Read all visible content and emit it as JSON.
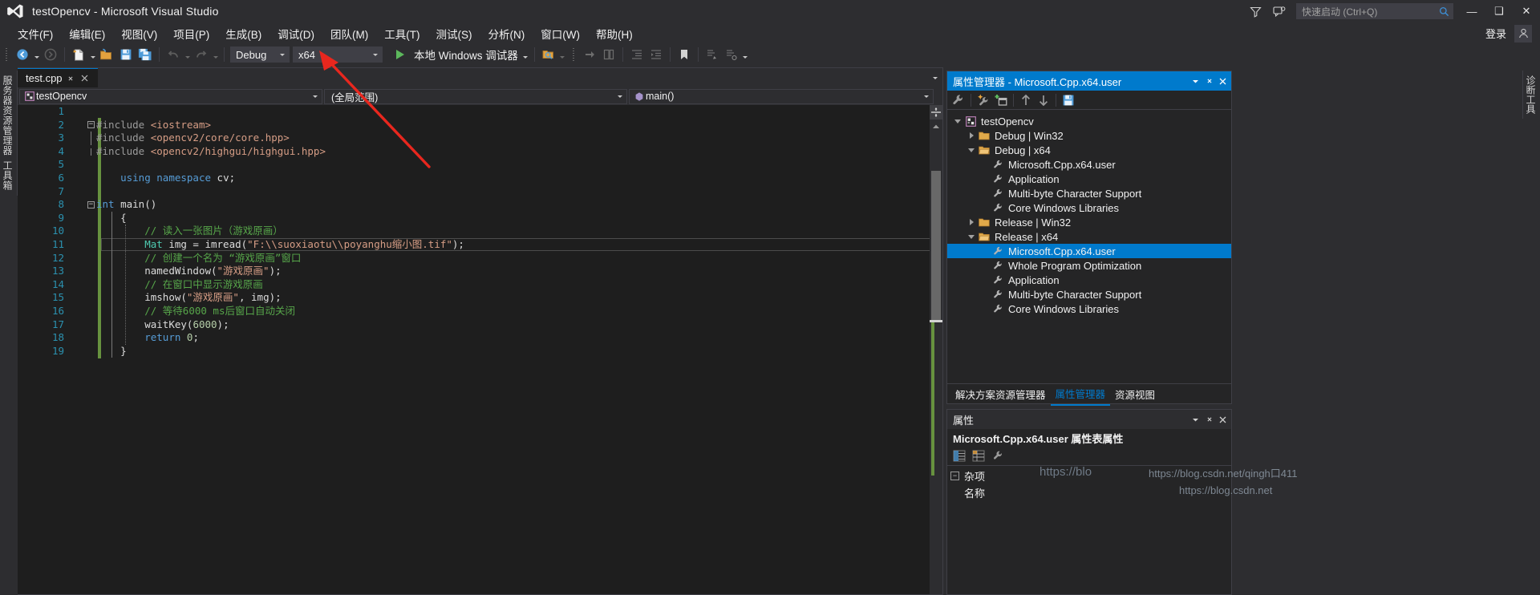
{
  "window": {
    "title": "testOpencv - Microsoft Visual Studio",
    "logo_name": "visual-studio-logo",
    "minimize": "—",
    "maximize": "❑",
    "close": "✕"
  },
  "titlebar": {
    "filter_icon": "feedback-filter-icon",
    "feedback_icon": "send-feedback-icon",
    "quick_launch_placeholder": "快速启动 (Ctrl+Q)",
    "quick_launch_value": "",
    "search_icon": "search-icon"
  },
  "menubar": {
    "items": [
      {
        "label": "文件(F)",
        "name": "menu-file"
      },
      {
        "label": "编辑(E)",
        "name": "menu-edit"
      },
      {
        "label": "视图(V)",
        "name": "menu-view"
      },
      {
        "label": "项目(P)",
        "name": "menu-project"
      },
      {
        "label": "生成(B)",
        "name": "menu-build"
      },
      {
        "label": "调试(D)",
        "name": "menu-debug"
      },
      {
        "label": "团队(M)",
        "name": "menu-team"
      },
      {
        "label": "工具(T)",
        "name": "menu-tools"
      },
      {
        "label": "测试(S)",
        "name": "menu-test"
      },
      {
        "label": "分析(N)",
        "name": "menu-analyze"
      },
      {
        "label": "窗口(W)",
        "name": "menu-window"
      },
      {
        "label": "帮助(H)",
        "name": "menu-help"
      }
    ],
    "signin_label": "登录",
    "account_icon": "account-icon"
  },
  "toolbar": {
    "back_icon": "navigate-back-icon",
    "forward_icon": "navigate-forward-icon",
    "new_item_icon": "new-item-icon",
    "open_icon": "open-file-icon",
    "save_icon": "save-icon",
    "save_all_icon": "save-all-icon",
    "undo_icon": "undo-icon",
    "redo_icon": "redo-icon",
    "config_label": "Debug",
    "platform_label": "x64",
    "run_label": "本地 Windows 调试器",
    "run_icon": "play-icon",
    "find_icon": "find-in-files-icon",
    "step_icons": [
      "step-over-icon",
      "step-into-icon"
    ],
    "indent_icons": [
      "decrease-indent-icon",
      "increase-indent-icon"
    ],
    "bookmark_icon": "bookmark-icon",
    "comment_icons": [
      "comment-icon",
      "uncomment-icon",
      "toggle-icon"
    ],
    "overflow_icon": "toolbar-overflow-icon"
  },
  "left_rail": {
    "tabs": [
      "服务器资源管理器",
      "工具箱"
    ]
  },
  "right_rail": {
    "tabs": [
      "诊断工具"
    ]
  },
  "editor": {
    "tab_label": "test.cpp",
    "tab_pin_icon": "pin-icon",
    "tab_close_icon": "close-icon",
    "tabstrip_menu_icon": "chevron-down-icon",
    "nav_project": "testOpencv",
    "nav_project_icon": "cpp-project-icon",
    "nav_scope": "(全局范围)",
    "nav_member": "main()",
    "nav_member_icon": "method-icon",
    "code_lines": [
      {
        "n": 1,
        "fold": "",
        "indent": 0,
        "tokens": []
      },
      {
        "n": 2,
        "fold": "minus",
        "indent": 0,
        "tokens": [
          {
            "t": "#include ",
            "c": "pp"
          },
          {
            "t": "<iostream>",
            "c": "hdr"
          }
        ]
      },
      {
        "n": 3,
        "fold": "bar",
        "indent": 0,
        "tokens": [
          {
            "t": "#include ",
            "c": "pp"
          },
          {
            "t": "<opencv2/core/core.hpp>",
            "c": "hdr"
          }
        ]
      },
      {
        "n": 4,
        "fold": "bar-end",
        "indent": 0,
        "tokens": [
          {
            "t": "#include ",
            "c": "pp"
          },
          {
            "t": "<opencv2/highgui/highgui.hpp>",
            "c": "hdr"
          }
        ]
      },
      {
        "n": 5,
        "fold": "",
        "indent": 0,
        "tokens": []
      },
      {
        "n": 6,
        "fold": "",
        "indent": 1,
        "tokens": [
          {
            "t": "using",
            "c": "kw"
          },
          {
            "t": " ",
            "c": ""
          },
          {
            "t": "namespace",
            "c": "kw"
          },
          {
            "t": " cv;",
            "c": ""
          }
        ]
      },
      {
        "n": 7,
        "fold": "",
        "indent": 0,
        "tokens": []
      },
      {
        "n": 8,
        "fold": "minus",
        "indent": 0,
        "tokens": [
          {
            "t": "int",
            "c": "kw"
          },
          {
            "t": " main()",
            "c": ""
          }
        ]
      },
      {
        "n": 9,
        "fold": "",
        "indent": 1,
        "tokens": [
          {
            "t": "{",
            "c": ""
          }
        ]
      },
      {
        "n": 10,
        "fold": "",
        "indent": 2,
        "tokens": [
          {
            "t": "// 读入一张图片（游戏原画）",
            "c": "cmt"
          }
        ]
      },
      {
        "n": 11,
        "fold": "",
        "indent": 2,
        "cur": true,
        "tokens": [
          {
            "t": "Mat",
            "c": "typ"
          },
          {
            "t": " img = imread(",
            "c": ""
          },
          {
            "t": "\"F:\\\\suoxiaotu\\\\poyanghu缩小图.tif\"",
            "c": "str"
          },
          {
            "t": ");",
            "c": ""
          }
        ]
      },
      {
        "n": 12,
        "fold": "",
        "indent": 2,
        "tokens": [
          {
            "t": "// 创建一个名为 “游戏原画”窗口",
            "c": "cmt"
          }
        ]
      },
      {
        "n": 13,
        "fold": "",
        "indent": 2,
        "tokens": [
          {
            "t": "namedWindow(",
            "c": ""
          },
          {
            "t": "\"游戏原画\"",
            "c": "str"
          },
          {
            "t": ");",
            "c": ""
          }
        ]
      },
      {
        "n": 14,
        "fold": "",
        "indent": 2,
        "tokens": [
          {
            "t": "// 在窗口中显示游戏原画",
            "c": "cmt"
          }
        ]
      },
      {
        "n": 15,
        "fold": "",
        "indent": 2,
        "tokens": [
          {
            "t": "imshow(",
            "c": ""
          },
          {
            "t": "\"游戏原画\"",
            "c": "str"
          },
          {
            "t": ", img);",
            "c": ""
          }
        ]
      },
      {
        "n": 16,
        "fold": "",
        "indent": 2,
        "tokens": [
          {
            "t": "// 等待6000 ms后窗口自动关闭",
            "c": "cmt"
          }
        ]
      },
      {
        "n": 17,
        "fold": "",
        "indent": 2,
        "tokens": [
          {
            "t": "waitKey(",
            "c": ""
          },
          {
            "t": "6000",
            "c": "num"
          },
          {
            "t": ");",
            "c": ""
          }
        ]
      },
      {
        "n": 18,
        "fold": "",
        "indent": 2,
        "tokens": [
          {
            "t": "return",
            "c": "kw"
          },
          {
            "t": " ",
            "c": ""
          },
          {
            "t": "0",
            "c": "num"
          },
          {
            "t": ";",
            "c": ""
          }
        ]
      },
      {
        "n": 19,
        "fold": "",
        "indent": 1,
        "tokens": [
          {
            "t": "}",
            "c": ""
          }
        ]
      }
    ],
    "scroll": {
      "split_icon": "split-view-icon",
      "up_icon": "scroll-up-icon"
    }
  },
  "property_manager": {
    "title": "属性管理器 - Microsoft.Cpp.x64.user",
    "dropdown_icon": "chevron-down-icon",
    "pin_icon": "pin-icon",
    "close_icon": "close-icon",
    "toolbar_icons": [
      "properties-wrench-icon",
      "add-new-project-property-sheet-icon",
      "add-existing-property-sheet-icon",
      "move-up-icon",
      "move-down-icon",
      "save-icon"
    ],
    "tree": [
      {
        "label": "testOpencv",
        "depth": 0,
        "twisty": "down",
        "icon": "cpp-project-icon",
        "selected": false
      },
      {
        "label": "Debug | Win32",
        "depth": 1,
        "twisty": "right",
        "icon": "folder-icon",
        "selected": false
      },
      {
        "label": "Debug | x64",
        "depth": 1,
        "twisty": "down",
        "icon": "folder-open-icon",
        "selected": false
      },
      {
        "label": "Microsoft.Cpp.x64.user",
        "depth": 2,
        "twisty": "none",
        "icon": "property-sheet-icon",
        "selected": false
      },
      {
        "label": "Application",
        "depth": 2,
        "twisty": "none",
        "icon": "property-sheet-icon",
        "selected": false
      },
      {
        "label": "Multi-byte Character Support",
        "depth": 2,
        "twisty": "none",
        "icon": "property-sheet-icon",
        "selected": false
      },
      {
        "label": "Core Windows Libraries",
        "depth": 2,
        "twisty": "none",
        "icon": "property-sheet-icon",
        "selected": false
      },
      {
        "label": "Release | Win32",
        "depth": 1,
        "twisty": "right",
        "icon": "folder-icon",
        "selected": false
      },
      {
        "label": "Release | x64",
        "depth": 1,
        "twisty": "down",
        "icon": "folder-open-icon",
        "selected": false
      },
      {
        "label": "Microsoft.Cpp.x64.user",
        "depth": 2,
        "twisty": "none",
        "icon": "property-sheet-icon",
        "selected": true
      },
      {
        "label": "Whole Program Optimization",
        "depth": 2,
        "twisty": "none",
        "icon": "property-sheet-icon",
        "selected": false
      },
      {
        "label": "Application",
        "depth": 2,
        "twisty": "none",
        "icon": "property-sheet-icon",
        "selected": false
      },
      {
        "label": "Multi-byte Character Support",
        "depth": 2,
        "twisty": "none",
        "icon": "property-sheet-icon",
        "selected": false
      },
      {
        "label": "Core Windows Libraries",
        "depth": 2,
        "twisty": "none",
        "icon": "property-sheet-icon",
        "selected": false
      }
    ],
    "tabs": [
      {
        "label": "解决方案资源管理器",
        "active": false
      },
      {
        "label": "属性管理器",
        "active": true
      },
      {
        "label": "资源视图",
        "active": false
      }
    ]
  },
  "properties": {
    "title": "属性",
    "dropdown_icon": "chevron-down-icon",
    "pin_icon": "pin-icon",
    "close_icon": "close-icon",
    "object_label": "Microsoft.Cpp.x64.user 属性表属性",
    "toolbar_icons": [
      "categorized-view-icon",
      "alphabetical-view-icon",
      "property-pages-icon"
    ],
    "rows": [
      {
        "label": "杂项",
        "expander": "-"
      },
      {
        "label": "名称",
        "expander": ""
      }
    ]
  },
  "watermarks": {
    "left": "https://blo",
    "overlay": "https://blog.csdn.net/qingh口411",
    "bottom": "https://blog.csdn.net"
  },
  "colors": {
    "accent": "#007acc",
    "chrome": "#2d2d30",
    "panel": "#252526",
    "editor_bg": "#1e1e1e",
    "keyword": "#569cd6",
    "string": "#d69d85",
    "comment": "#57a64a",
    "type": "#4ec9b0",
    "number": "#b5cea8",
    "linenum": "#2b91af",
    "track_green": "#67923f",
    "arrow_red": "#e8271e"
  }
}
